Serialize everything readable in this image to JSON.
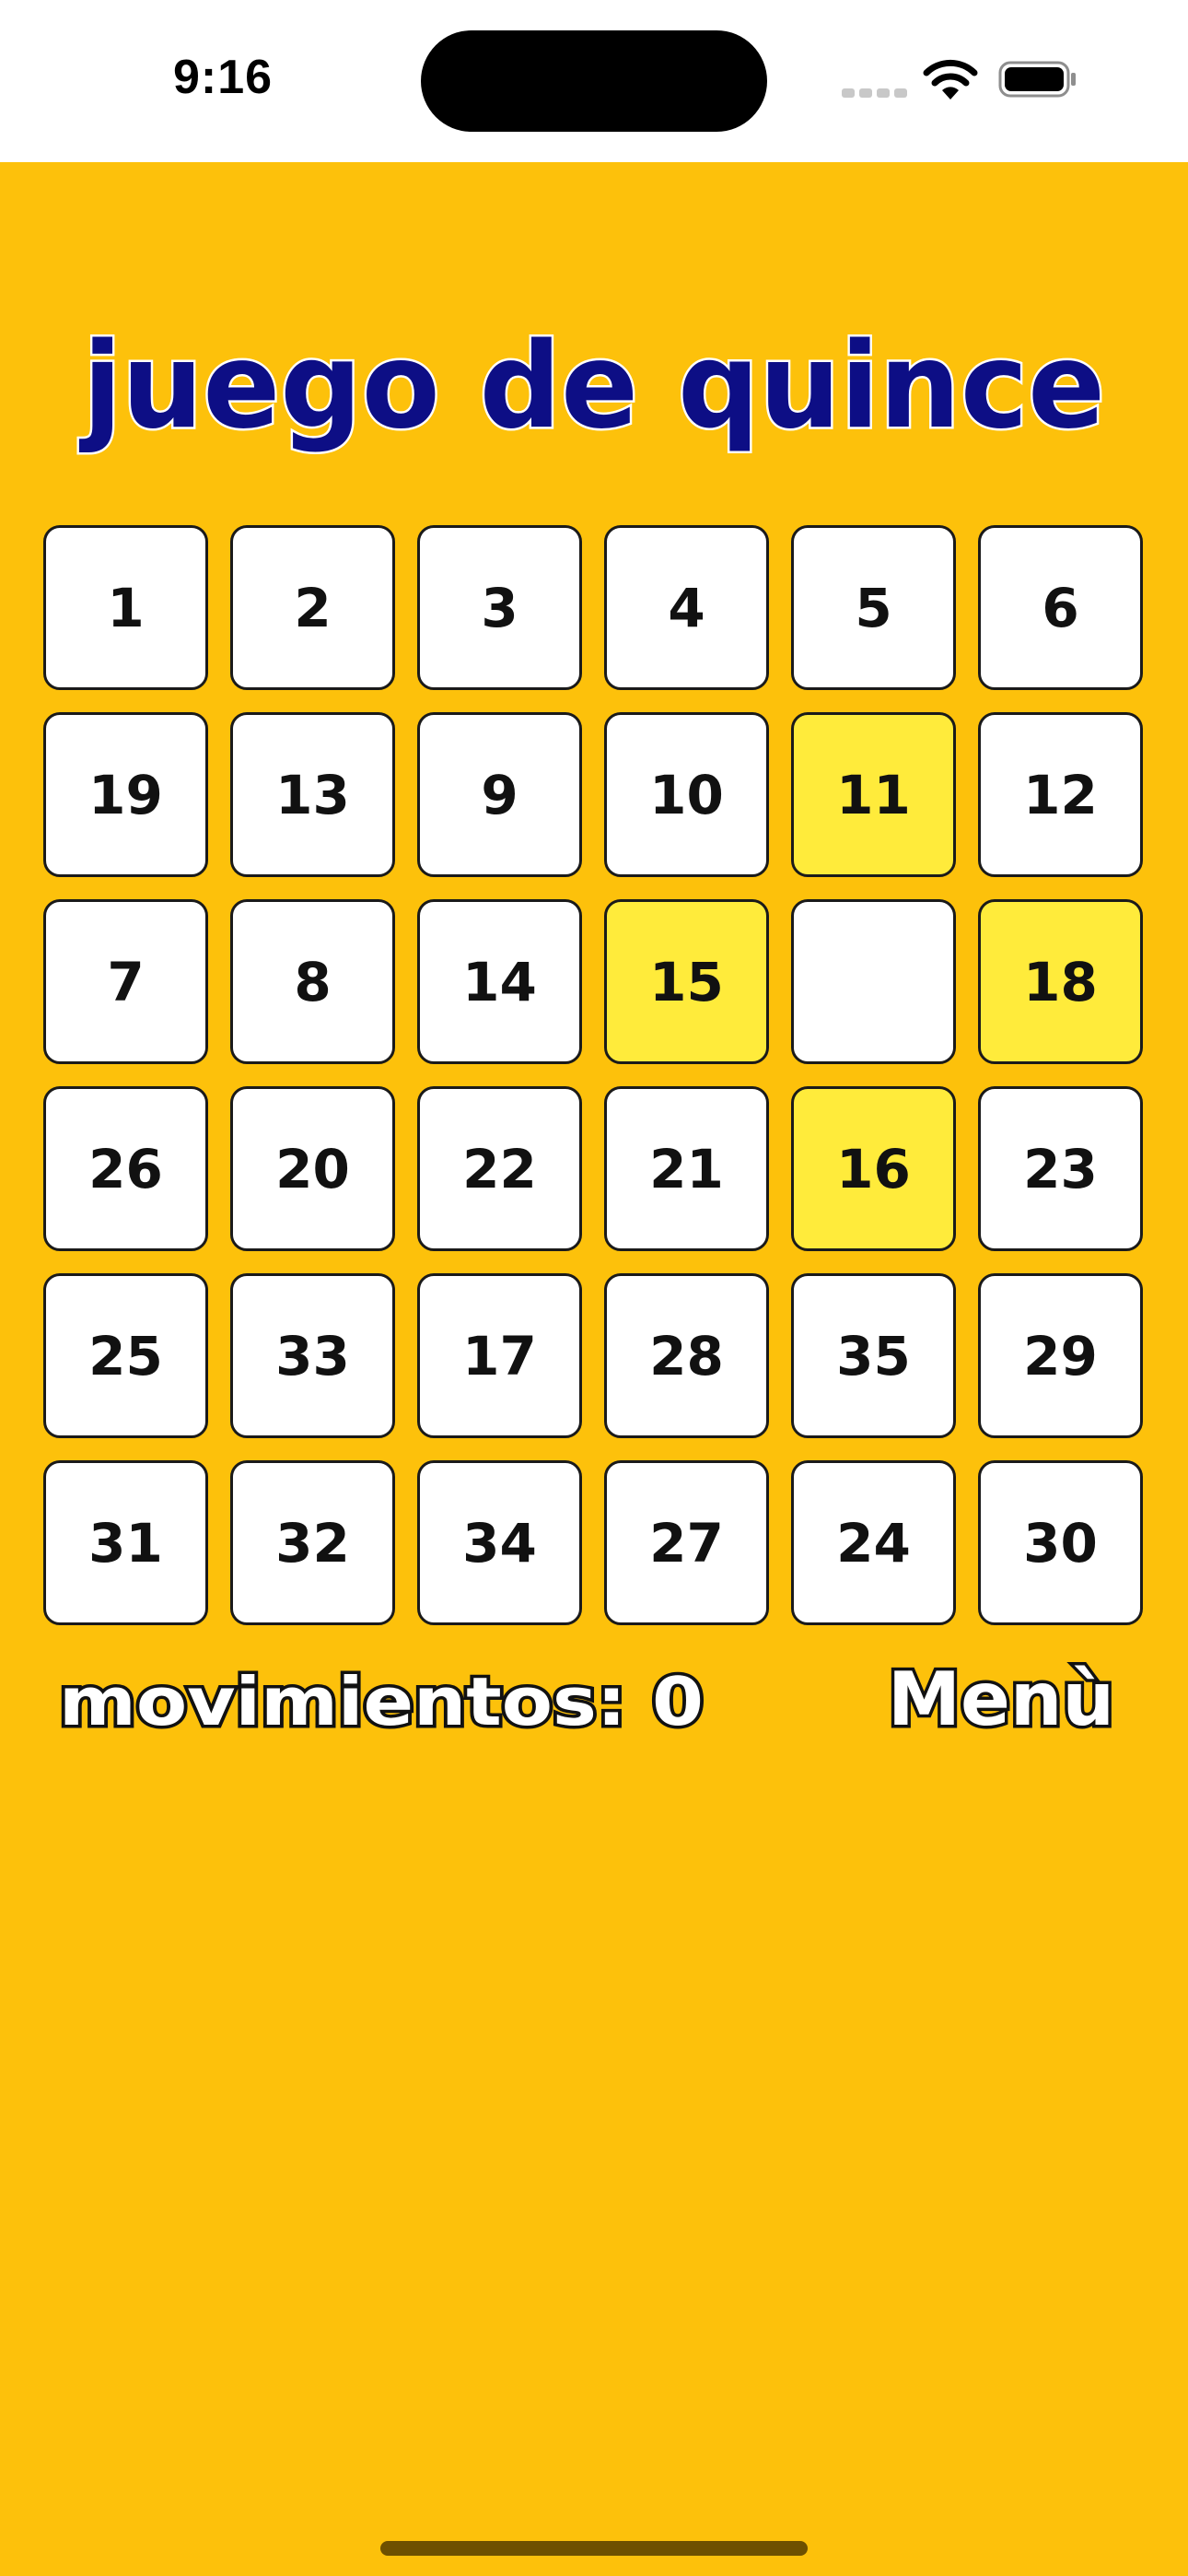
{
  "status_bar": {
    "time": "9:16"
  },
  "title": "juego de quince",
  "board": {
    "rows": [
      [
        {
          "label": "1"
        },
        {
          "label": "2"
        },
        {
          "label": "3"
        },
        {
          "label": "4"
        },
        {
          "label": "5"
        },
        {
          "label": "6"
        }
      ],
      [
        {
          "label": "19"
        },
        {
          "label": "13"
        },
        {
          "label": "9"
        },
        {
          "label": "10"
        },
        {
          "label": "11",
          "highlight": true
        },
        {
          "label": "12"
        }
      ],
      [
        {
          "label": "7"
        },
        {
          "label": "8"
        },
        {
          "label": "14"
        },
        {
          "label": "15",
          "highlight": true
        },
        {
          "label": "",
          "empty": true
        },
        {
          "label": "18",
          "highlight": true
        }
      ],
      [
        {
          "label": "26"
        },
        {
          "label": "20"
        },
        {
          "label": "22"
        },
        {
          "label": "21"
        },
        {
          "label": "16",
          "highlight": true
        },
        {
          "label": "23"
        }
      ],
      [
        {
          "label": "25"
        },
        {
          "label": "33"
        },
        {
          "label": "17"
        },
        {
          "label": "28"
        },
        {
          "label": "35"
        },
        {
          "label": "29"
        }
      ],
      [
        {
          "label": "31"
        },
        {
          "label": "32"
        },
        {
          "label": "34"
        },
        {
          "label": "27"
        },
        {
          "label": "24"
        },
        {
          "label": "30"
        }
      ]
    ]
  },
  "footer": {
    "moves_text": "movimientos: 0",
    "menu_label": "Menù"
  },
  "colors": {
    "background": "#FDC10B",
    "tile": "#FFFFFF",
    "tile_highlight": "#FFEB3B",
    "title_fill": "#0D0E85",
    "label_fill": "#FFFFFF",
    "outline": "#111111"
  }
}
